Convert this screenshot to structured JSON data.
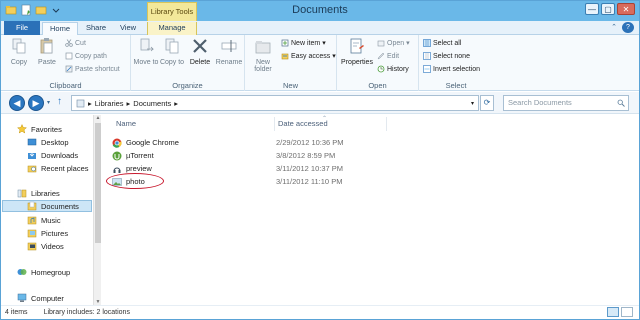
{
  "window": {
    "title": "Documents",
    "contextual_tab_group": "Library Tools"
  },
  "window_controls": {
    "minimize": "—",
    "maximize": "▢",
    "close": "✕"
  },
  "tabs": [
    {
      "label": "File"
    },
    {
      "label": "Home"
    },
    {
      "label": "Share"
    },
    {
      "label": "View"
    },
    {
      "label": "Manage"
    }
  ],
  "ribbon": {
    "clipboard": {
      "label": "Clipboard",
      "copy": "Copy",
      "paste": "Paste",
      "cut": "Cut",
      "copy_path": "Copy path",
      "paste_shortcut": "Paste shortcut"
    },
    "organize": {
      "label": "Organize",
      "move_to": "Move to",
      "copy_to": "Copy to",
      "delete": "Delete",
      "rename": "Rename"
    },
    "new": {
      "label": "New",
      "new_folder": "New folder",
      "new_item": "New item",
      "easy_access": "Easy access"
    },
    "open": {
      "label": "Open",
      "properties": "Properties",
      "open": "Open",
      "edit": "Edit",
      "history": "History"
    },
    "select": {
      "label": "Select",
      "select_all": "Select all",
      "select_none": "Select none",
      "invert_selection": "Invert selection"
    }
  },
  "address": {
    "crumbs": [
      "Libraries",
      "Documents"
    ],
    "search_placeholder": "Search Documents"
  },
  "nav": {
    "favorites": "Favorites",
    "desktop": "Desktop",
    "downloads": "Downloads",
    "recent_places": "Recent places",
    "libraries": "Libraries",
    "documents": "Documents",
    "music": "Music",
    "pictures": "Pictures",
    "videos": "Videos",
    "homegroup": "Homegroup",
    "computer": "Computer"
  },
  "columns": {
    "name": "Name",
    "date_accessed": "Date accessed"
  },
  "files": [
    {
      "name": "Google Chrome",
      "date": "2/29/2012 10:36 PM"
    },
    {
      "name": "µTorrent",
      "date": "3/8/2012 8:59 PM"
    },
    {
      "name": "preview",
      "date": "3/11/2012 10:37 PM"
    },
    {
      "name": "photo",
      "date": "3/11/2012 11:10 PM"
    }
  ],
  "status": {
    "items": "4 items",
    "library_info": "Library includes: 2 locations"
  },
  "colors": {
    "titlebar": "#6ab8e8",
    "file_tab": "#2b71b8",
    "selection": "#cde6f7",
    "annotation_circle": "#c8192e"
  }
}
